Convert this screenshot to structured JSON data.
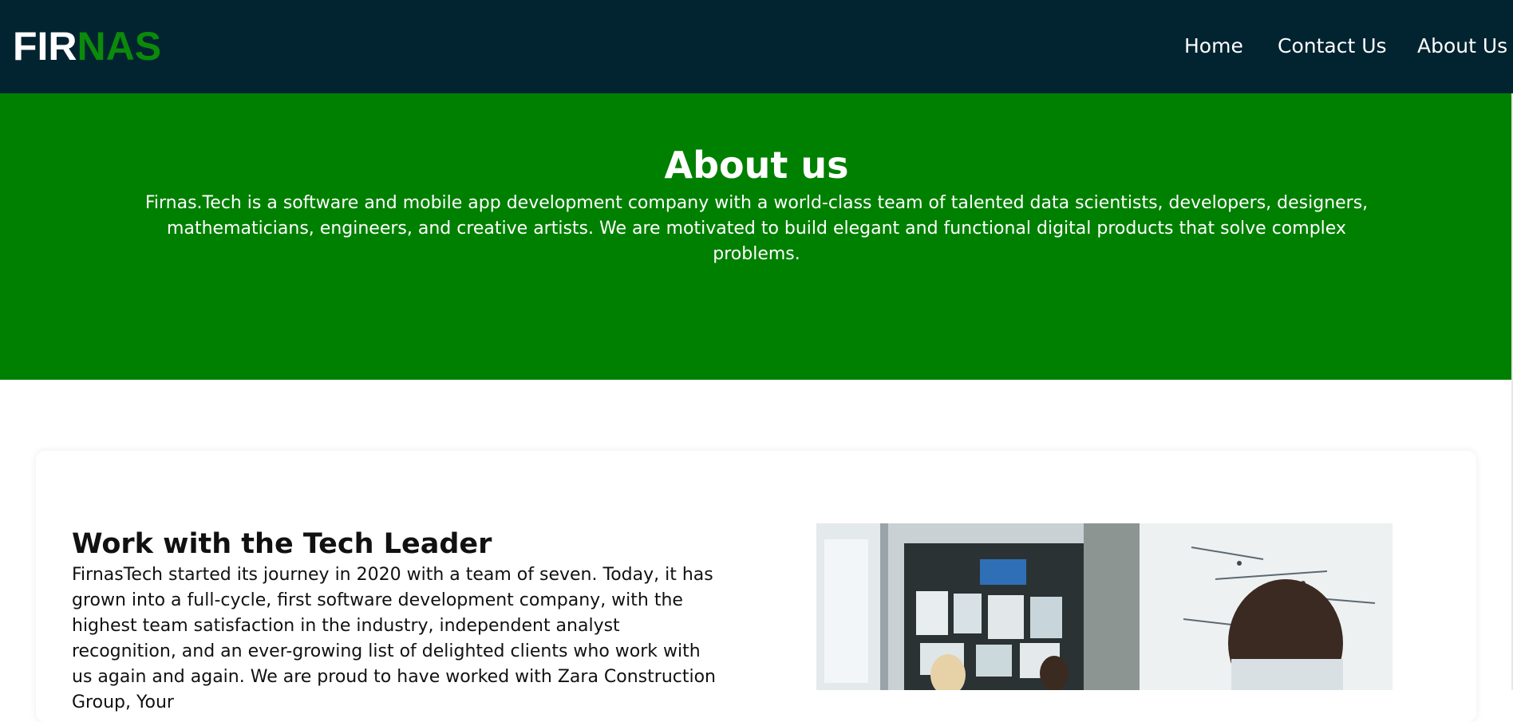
{
  "navbar": {
    "logo": {
      "part1": "FIR",
      "part2": "NAS"
    },
    "links": [
      "Home",
      "Contact Us",
      "About Us"
    ]
  },
  "hero": {
    "title": "About us",
    "text": "Firnas.Tech is a software and mobile app development company with a world-class team of talented data scientists, developers, designers, mathematicians, engineers, and creative artists. We are motivated to build elegant and functional digital products that solve complex problems."
  },
  "section": {
    "title": "Work with the Tech Leader",
    "text": "FirnasTech started its journey in 2020 with a team of seven. Today, it has grown into a full-cycle, first software development company, with the highest team satisfaction in the industry, independent analyst recognition, and an ever-growing list of delighted clients who work with us again and again. We are proud to have worked with Zara Construction Group, Your"
  },
  "colors": {
    "navbar_bg": "#022430",
    "hero_bg": "#008000",
    "logo_accent": "#0b8a0b"
  }
}
